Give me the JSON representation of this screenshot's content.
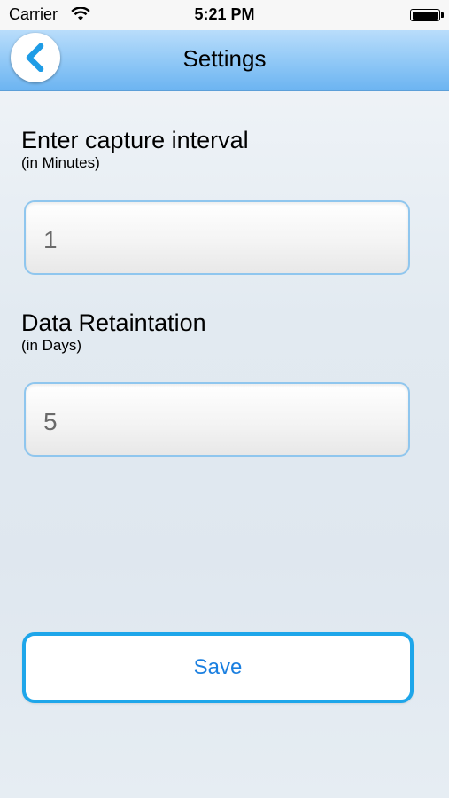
{
  "status_bar": {
    "carrier": "Carrier",
    "time": "5:21 PM",
    "wifi_icon": "wifi-icon",
    "battery_icon": "battery-icon"
  },
  "nav": {
    "title": "Settings",
    "back_icon": "chevron-left-icon"
  },
  "capture": {
    "label": "Enter capture interval",
    "sublabel": "(in Minutes)",
    "value": "1"
  },
  "retention": {
    "label": "Data Retaintation",
    "sublabel": "(in Days)",
    "value": "5"
  },
  "actions": {
    "save_label": "Save"
  },
  "colors": {
    "nav_blue": "#8ec7f6",
    "accent": "#1ea6ea",
    "save_text": "#1a7fe0",
    "field_border": "#8fc6ee"
  }
}
